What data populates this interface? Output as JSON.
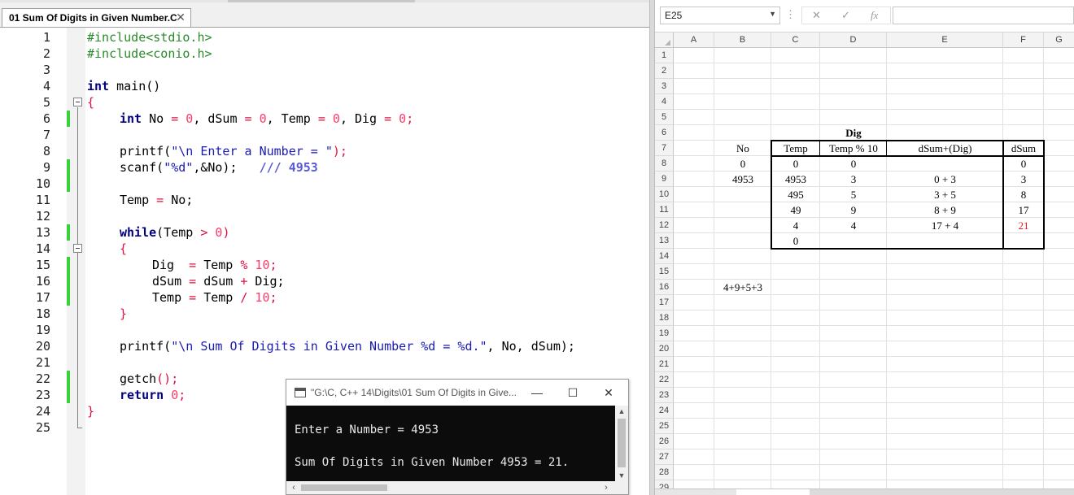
{
  "editor": {
    "tab_title": "01 Sum Of Digits in Given Number.C",
    "tab_close": "✕",
    "line_numbers": [
      "1",
      "2",
      "3",
      "4",
      "5",
      "6",
      "7",
      "8",
      "9",
      "10",
      "11",
      "12",
      "13",
      "14",
      "15",
      "16",
      "17",
      "18",
      "19",
      "20",
      "21",
      "22",
      "23",
      "24",
      "25"
    ],
    "code": {
      "l1": "#include<stdio.h>",
      "l2": "#include<conio.h>",
      "l4_kw": "int",
      "l4_rest": " main()",
      "l5": "{",
      "l6_kw": "int",
      "l6_a": " No ",
      "l6_b": "=",
      "l6_c": " 0",
      "l6_d": ", dSum ",
      "l6_e": "=",
      "l6_f": " 0",
      "l6_g": ", Temp ",
      "l6_h": "=",
      "l6_i": " 0",
      "l6_j": ", Dig ",
      "l6_k": "=",
      "l6_l": " 0",
      "l6_m": ";",
      "l8_a": "printf(",
      "l8_b": "\"\\n Enter a Number = \"",
      "l8_c": ");",
      "l9_a": "scanf(",
      "l9_b": "\"%d\"",
      "l9_c": ",&No);   ",
      "l9_cmt": "/// 4953",
      "l11_a": "Temp ",
      "l11_b": "=",
      "l11_c": " No;",
      "l13_kw": "while",
      "l13_a": "(Temp ",
      "l13_b": ">",
      "l13_c": " 0",
      "l13_d": ")",
      "l14": "{",
      "l15_a": "Dig  ",
      "l15_b": "=",
      "l15_c": " Temp ",
      "l15_d": "%",
      "l15_e": " 10",
      "l15_f": ";",
      "l16_a": "dSum ",
      "l16_b": "=",
      "l16_c": " dSum ",
      "l16_d": "+",
      "l16_e": " Dig;",
      "l17_a": "Temp ",
      "l17_b": "=",
      "l17_c": " Temp ",
      "l17_d": "/",
      "l17_e": " 10",
      "l17_f": ";",
      "l18": "}",
      "l20_a": "printf(",
      "l20_b": "\"\\n Sum Of Digits in Given Number %d = %d.\"",
      "l20_c": ", No, dSum);",
      "l22_a": "getch",
      "l22_b": "();",
      "l23_kw": "return",
      "l23_a": " 0",
      "l23_b": ";",
      "l24": "}"
    }
  },
  "console": {
    "title": "\"G:\\C, C++ 14\\Digits\\01 Sum Of Digits in Give...",
    "minimize": "—",
    "maximize": "☐",
    "close": "✕",
    "output_line1": "Enter a Number = 4953",
    "output_line2": "Sum Of Digits in Given Number 4953 = 21."
  },
  "spreadsheet": {
    "name_box": "E25",
    "formula_buttons": {
      "cancel": "✕",
      "enter": "✓",
      "function": "fx"
    },
    "columns": [
      "A",
      "B",
      "C",
      "D",
      "E",
      "F",
      "G"
    ],
    "rows": [
      "1",
      "2",
      "3",
      "4",
      "5",
      "6",
      "7",
      "8",
      "9",
      "10",
      "11",
      "12",
      "13",
      "14",
      "15",
      "16",
      "17",
      "18",
      "19",
      "20",
      "21",
      "22",
      "23",
      "24",
      "25",
      "26",
      "27",
      "28",
      "29"
    ],
    "cells": {
      "D6": "Dig",
      "B7": "No",
      "C7": "Temp",
      "D7": "Temp % 10",
      "E7": "dSum+(Dig)",
      "F7": "dSum",
      "B8": "0",
      "C8": "0",
      "D8": "0",
      "F8": "0",
      "B9": "4953",
      "C9": "4953",
      "D9": "3",
      "E9": "0 + 3",
      "F9": "3",
      "C10": "495",
      "D10": "5",
      "E10": "3 + 5",
      "F10": "8",
      "C11": "49",
      "D11": "9",
      "E11": "8 + 9",
      "F11": "17",
      "C12": "4",
      "D12": "4",
      "E12": "17 + 4",
      "F12": "21",
      "C13": "0",
      "B16": "4+9+5+3"
    },
    "highlight_color": "#e02020"
  }
}
